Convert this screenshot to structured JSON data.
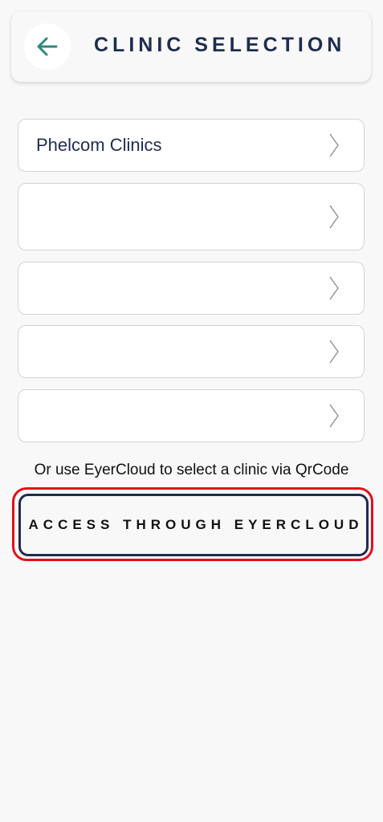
{
  "header": {
    "back_icon": "arrow-left-icon",
    "title": "CLINIC SELECTION"
  },
  "clinics": [
    {
      "label": "Phelcom Clinics",
      "icon": "chevron-right-icon"
    },
    {
      "label": "",
      "icon": "chevron-right-icon"
    },
    {
      "label": "",
      "icon": "chevron-right-icon"
    },
    {
      "label": "",
      "icon": "chevron-right-icon"
    },
    {
      "label": "",
      "icon": "chevron-right-icon"
    }
  ],
  "qr_prompt": "Or use EyerCloud to select a clinic via QrCode",
  "access_button": {
    "label": "ACCESS THROUGH EYERCLOUD"
  },
  "colors": {
    "background": "#f8f8f8",
    "title": "#1e2c4f",
    "back_arrow": "#2e8a7a",
    "highlight": "#e0111b",
    "button_border": "#1e2c4f"
  }
}
